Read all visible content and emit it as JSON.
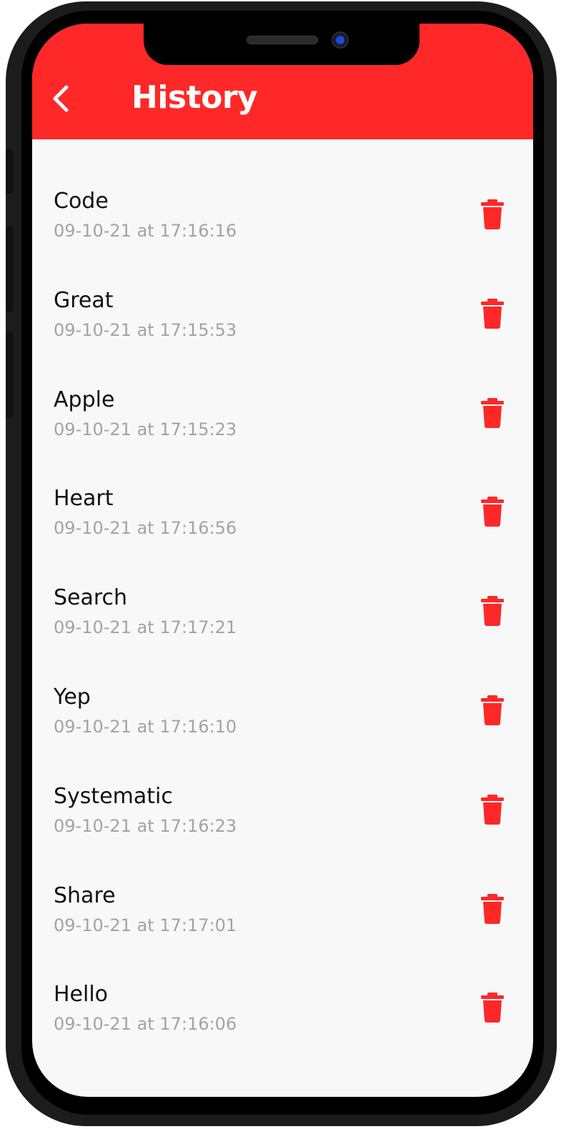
{
  "header": {
    "title": "History",
    "background_color": "#ff2828",
    "back_icon": "chevron-left-icon"
  },
  "history": {
    "delete_icon": "trash-icon",
    "accent_color": "#ff2828",
    "items": [
      {
        "word": "Code",
        "timestamp": "09-10-21 at 17:16:16"
      },
      {
        "word": "Great",
        "timestamp": "09-10-21 at 17:15:53"
      },
      {
        "word": "Apple",
        "timestamp": "09-10-21 at 17:15:23"
      },
      {
        "word": "Heart",
        "timestamp": "09-10-21 at 17:16:56"
      },
      {
        "word": "Search",
        "timestamp": "09-10-21 at 17:17:21"
      },
      {
        "word": "Yep",
        "timestamp": "09-10-21 at 17:16:10"
      },
      {
        "word": "Systematic",
        "timestamp": "09-10-21 at 17:16:23"
      },
      {
        "word": "Share",
        "timestamp": "09-10-21 at 17:17:01"
      },
      {
        "word": "Hello",
        "timestamp": "09-10-21 at 17:16:06"
      }
    ]
  }
}
